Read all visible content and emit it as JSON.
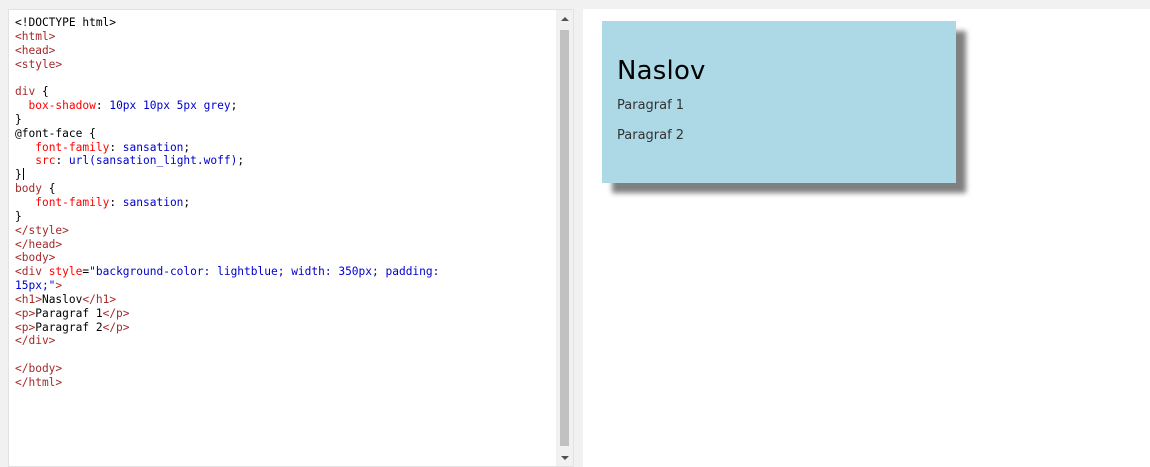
{
  "editor": {
    "lines": [
      [
        {
          "t": "<!DOCTYPE html>",
          "c": "at"
        }
      ],
      [
        {
          "t": "<html>",
          "c": "tag"
        }
      ],
      [
        {
          "t": "<head>",
          "c": "tag"
        }
      ],
      [
        {
          "t": "<style>",
          "c": "tag"
        }
      ],
      [
        {
          "t": "",
          "c": "at"
        }
      ],
      [
        {
          "t": "div",
          "c": "sel"
        },
        {
          "t": " {",
          "c": "at"
        }
      ],
      [
        {
          "t": "  ",
          "c": "at"
        },
        {
          "t": "box-shadow",
          "c": "prop"
        },
        {
          "t": ": ",
          "c": "at"
        },
        {
          "t": "10px 10px 5px grey",
          "c": "val"
        },
        {
          "t": ";",
          "c": "at"
        }
      ],
      [
        {
          "t": "}",
          "c": "at"
        }
      ],
      [
        {
          "t": "@font-face {",
          "c": "at"
        }
      ],
      [
        {
          "t": "   ",
          "c": "at"
        },
        {
          "t": "font-family",
          "c": "prop"
        },
        {
          "t": ": ",
          "c": "at"
        },
        {
          "t": "sansation",
          "c": "val"
        },
        {
          "t": ";",
          "c": "at"
        }
      ],
      [
        {
          "t": "   ",
          "c": "at"
        },
        {
          "t": "src",
          "c": "prop"
        },
        {
          "t": ": ",
          "c": "at"
        },
        {
          "t": "url(sansation_light.woff)",
          "c": "val"
        },
        {
          "t": ";",
          "c": "at"
        }
      ],
      [
        {
          "t": "}",
          "c": "at"
        },
        {
          "cursor": true
        }
      ],
      [
        {
          "t": "body",
          "c": "sel"
        },
        {
          "t": " {",
          "c": "at"
        }
      ],
      [
        {
          "t": "   ",
          "c": "at"
        },
        {
          "t": "font-family",
          "c": "prop"
        },
        {
          "t": ": ",
          "c": "at"
        },
        {
          "t": "sansation",
          "c": "val"
        },
        {
          "t": ";",
          "c": "at"
        }
      ],
      [
        {
          "t": "}",
          "c": "at"
        }
      ],
      [
        {
          "t": "</style>",
          "c": "tag"
        }
      ],
      [
        {
          "t": "</head>",
          "c": "tag"
        }
      ],
      [
        {
          "t": "<body>",
          "c": "tag"
        }
      ],
      [
        {
          "t": "<div",
          "c": "tag"
        },
        {
          "t": " style",
          "c": "attr"
        },
        {
          "t": "=",
          "c": "at"
        },
        {
          "t": "\"background-color: lightblue; width: 350px; padding:",
          "c": "str"
        }
      ],
      [
        {
          "t": "15px;\"",
          "c": "str"
        },
        {
          "t": ">",
          "c": "tag"
        }
      ],
      [
        {
          "t": "<h1>",
          "c": "tag"
        },
        {
          "t": "Naslov",
          "c": "at"
        },
        {
          "t": "</h1>",
          "c": "tag"
        }
      ],
      [
        {
          "t": "<p>",
          "c": "tag"
        },
        {
          "t": "Paragraf 1",
          "c": "at"
        },
        {
          "t": "</p>",
          "c": "tag"
        }
      ],
      [
        {
          "t": "<p>",
          "c": "tag"
        },
        {
          "t": "Paragraf 2",
          "c": "at"
        },
        {
          "t": "</p>",
          "c": "tag"
        }
      ],
      [
        {
          "t": "</div>",
          "c": "tag"
        }
      ],
      [
        {
          "t": "",
          "c": "at"
        }
      ],
      [
        {
          "t": "</body>",
          "c": "tag"
        }
      ],
      [
        {
          "t": "</html>",
          "c": "tag"
        }
      ]
    ]
  },
  "result": {
    "heading": "Naslov",
    "paragraph1": "Paragraf 1",
    "paragraph2": "Paragraf 2",
    "box_background": "#add8e6",
    "shadow_color": "#808080"
  },
  "icons": {
    "scroll_up": "triangle-up-icon",
    "scroll_down": "triangle-down-icon"
  }
}
